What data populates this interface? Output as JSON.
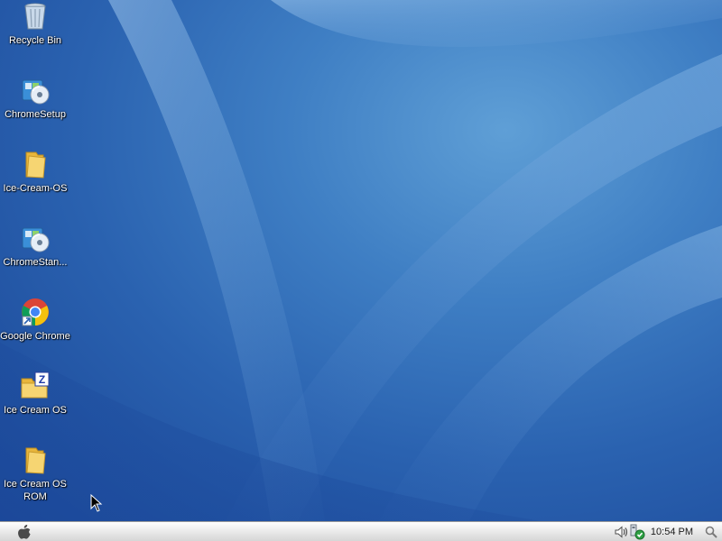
{
  "desktop": {
    "icons": [
      {
        "label": "Recycle Bin",
        "icon": "recycle-bin-icon"
      },
      {
        "label": "ChromeSetup",
        "icon": "installer-icon"
      },
      {
        "label": "Ice-Cream-OS",
        "icon": "folder-icon"
      },
      {
        "label": "ChromeStan...",
        "icon": "installer-icon"
      },
      {
        "label": "Google Chrome",
        "icon": "chrome-icon"
      },
      {
        "label": "Ice Cream OS",
        "icon": "zip-folder-icon"
      },
      {
        "label": "Ice Cream OS\nROM",
        "icon": "folder-icon"
      }
    ]
  },
  "taskbar": {
    "start_icon": "apple-icon",
    "tray": {
      "volume_icon": "volume-icon",
      "network_icon": "network-shield-icon",
      "clock": "10:54 PM",
      "search_icon": "search-icon"
    }
  },
  "colors": {
    "desktop_blue": "#2a62b0",
    "taskbar_light": "#ececec",
    "folder_yellow": "#f2c74e"
  }
}
